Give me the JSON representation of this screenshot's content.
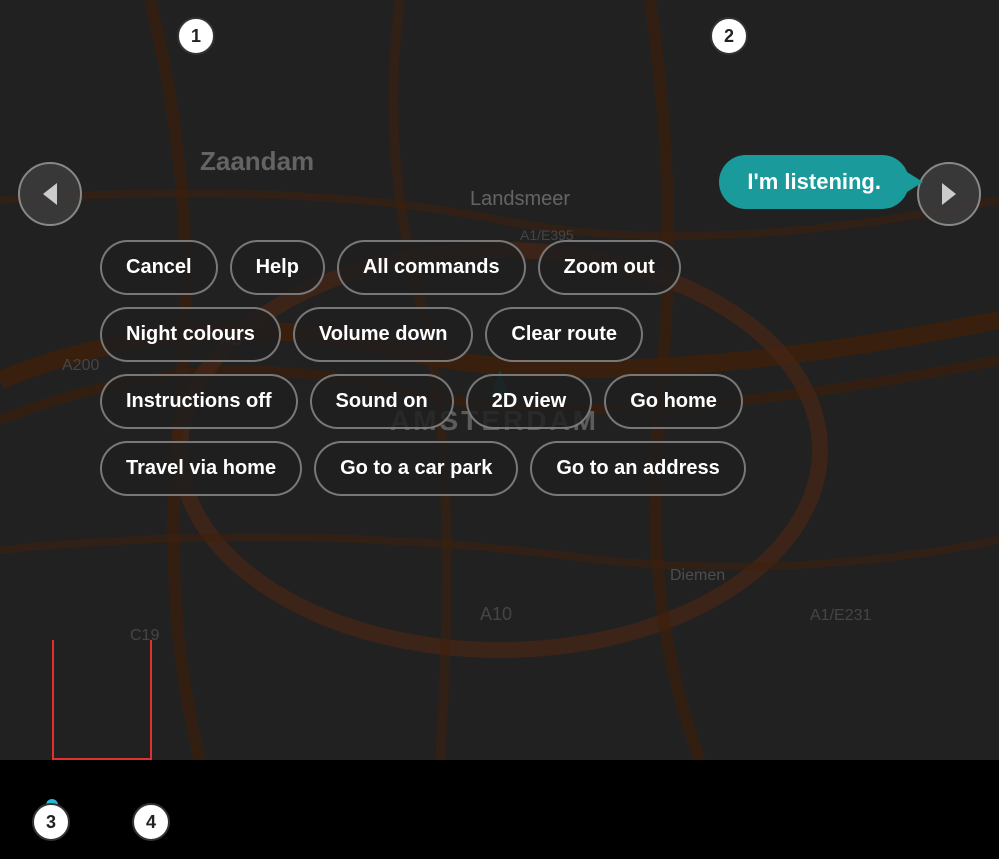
{
  "map": {
    "city1": "Zaandam",
    "city2": "Landsmeer",
    "city3": "AMSTERDAM"
  },
  "speech_bubble": {
    "text": "I'm listening."
  },
  "callouts": {
    "c1": "1",
    "c2": "2",
    "c3": "3",
    "c4": "4"
  },
  "nav_buttons": {
    "left_arrow": "◀",
    "right_arrow": "▶"
  },
  "commands": {
    "row1": [
      {
        "id": "cancel",
        "label": "Cancel"
      },
      {
        "id": "help",
        "label": "Help"
      },
      {
        "id": "all-commands",
        "label": "All commands"
      },
      {
        "id": "zoom-out",
        "label": "Zoom out"
      }
    ],
    "row2": [
      {
        "id": "night-colours",
        "label": "Night colours"
      },
      {
        "id": "volume-down",
        "label": "Volume down"
      },
      {
        "id": "clear-route",
        "label": "Clear route"
      }
    ],
    "row3": [
      {
        "id": "instructions-off",
        "label": "Instructions off"
      },
      {
        "id": "sound-on",
        "label": "Sound on"
      },
      {
        "id": "2d-view",
        "label": "2D view"
      },
      {
        "id": "go-home",
        "label": "Go home"
      }
    ],
    "row4": [
      {
        "id": "travel-via-home",
        "label": "Travel via home"
      },
      {
        "id": "go-to-car-park",
        "label": "Go to a car park"
      },
      {
        "id": "go-to-address",
        "label": "Go to an address"
      }
    ]
  }
}
